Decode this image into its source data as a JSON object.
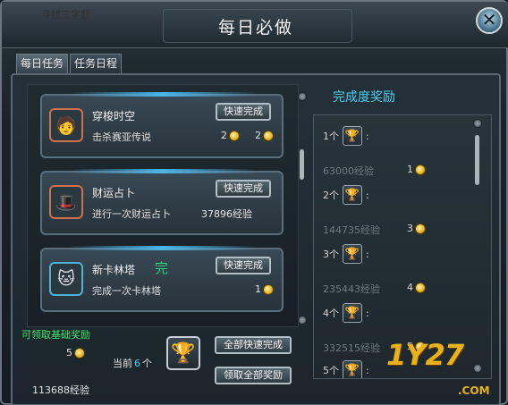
{
  "window": {
    "title": "每日必做",
    "bg_text": "寻找三字题",
    "close_icon": "✕"
  },
  "tabs": [
    {
      "label": "每日任务",
      "active": true
    },
    {
      "label": "任务日程",
      "active": false
    }
  ],
  "tasks": [
    {
      "name": "穿梭时空",
      "desc": "击杀赛亚传说",
      "button": "快速完成",
      "reward1_count": "2",
      "reward2_count": "2",
      "icon": "hero-portrait-icon"
    },
    {
      "name": "财运占卜",
      "desc": "进行一次财运占卜",
      "button": "快速完成",
      "exp": "37896经验",
      "icon": "fortune-portrait-icon"
    },
    {
      "name": "新卡林塔",
      "desc": "完成一次卡林塔",
      "button": "快速完成",
      "done_mark": "完",
      "reward_count": "1",
      "icon": "cat-portrait-icon"
    }
  ],
  "basic_reward": {
    "title": "可领取基础奖励",
    "coin_count": "5",
    "exp": "113688经验",
    "current_label_prefix": "当前",
    "current_value": "6",
    "current_label_suffix": "个",
    "quick_all_button": "全部快速完成",
    "claim_all_button": "领取全部奖励"
  },
  "progress": {
    "title": "完成度奖励",
    "rows": [
      {
        "count": "1个",
        "sep": ":"
      },
      {
        "exp": "63000经验",
        "coin": "1"
      },
      {
        "count": "2个",
        "sep": ":"
      },
      {
        "exp": "144735经验",
        "coin": "3"
      },
      {
        "count": "3个",
        "sep": ":"
      },
      {
        "exp": "235443经验",
        "coin": "4"
      },
      {
        "count": "4个",
        "sep": ":"
      },
      {
        "exp": "332515经验",
        "coin": "5"
      },
      {
        "count": "5个",
        "sep": ":"
      }
    ]
  },
  "watermark": {
    "main": "1Y27",
    "sub": ".COM"
  },
  "colors": {
    "accent": "#4ecbf0",
    "green": "#3ee36a",
    "gold": "#e8b21a"
  }
}
